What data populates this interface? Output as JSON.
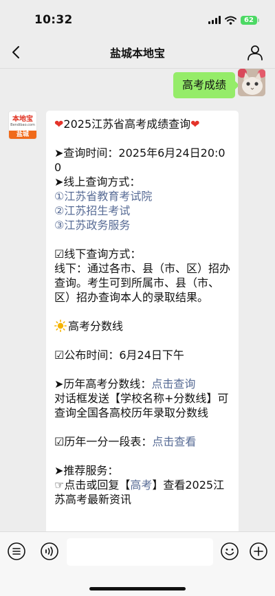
{
  "status_bar": {
    "time": "10:32",
    "battery": "62"
  },
  "nav": {
    "title": "盐城本地宝"
  },
  "user_message": {
    "text": "高考成绩"
  },
  "bot_avatar": {
    "logo_text": "本地宝",
    "logo_sub": "Bendibao.com",
    "city": "盐城"
  },
  "bot_message": {
    "title": "2025江苏省高考成绩查询",
    "query_time": "➤查询时间：2025年6月24日20:00",
    "online_title": "➤线上查询方式：",
    "online_links": [
      "①江苏省教育考试院",
      "②江苏招生考试",
      "③江苏政务服务"
    ],
    "offline_title": "☑线下查询方式：",
    "offline_text": "线下：通过各市、县（市、区）招办查询。考生可到所属市、县（市、区）招办查询本人的录取结果。",
    "score_line_title": "高考分数线",
    "publish_time": "☑公布时间：6月24日下午",
    "history_prefix": "➤历年高考分数线：",
    "history_link": "点击查询",
    "history_text": "对话框发送【学校名称+分数线】可查询全国各高校历年录取分数线",
    "segment_prefix": "☑历年一分一段表：",
    "segment_link": "点击查看",
    "recommend_title": "➤推荐服务：",
    "recommend_prefix": "☞点击或回复【",
    "recommend_link": "高考",
    "recommend_suffix": "】查看2025江苏高考最新资讯"
  },
  "colors": {
    "user_bubble": "#95ec69",
    "link": "#576b95",
    "background": "#ededed",
    "heart": "#e4332a",
    "sun": "#f5b400"
  },
  "icons": {
    "back": "chevron-left-icon",
    "profile": "person-icon",
    "menu": "list-menu-icon",
    "voice": "voice-icon",
    "emoji": "emoji-icon",
    "add": "plus-circle-icon"
  }
}
